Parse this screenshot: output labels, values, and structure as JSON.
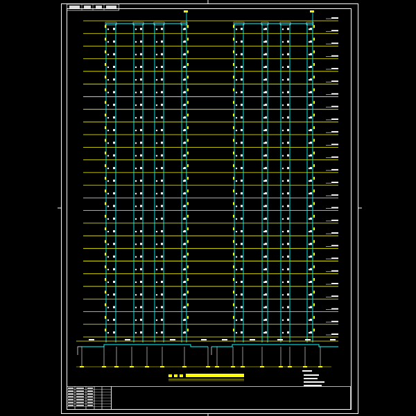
{
  "title_block": {
    "header_text": "",
    "title_text": "",
    "rows": 8
  },
  "drawing": {
    "main_title": "",
    "notes": [
      "",
      "",
      "",
      ""
    ],
    "floor_count": 26,
    "towers": 2
  },
  "colors": {
    "background": "#000000",
    "frame": "#ffffff",
    "floor_line": "#ffff00",
    "riser": "#00ffff",
    "label": "#ffffff",
    "title": "#ffff00"
  }
}
